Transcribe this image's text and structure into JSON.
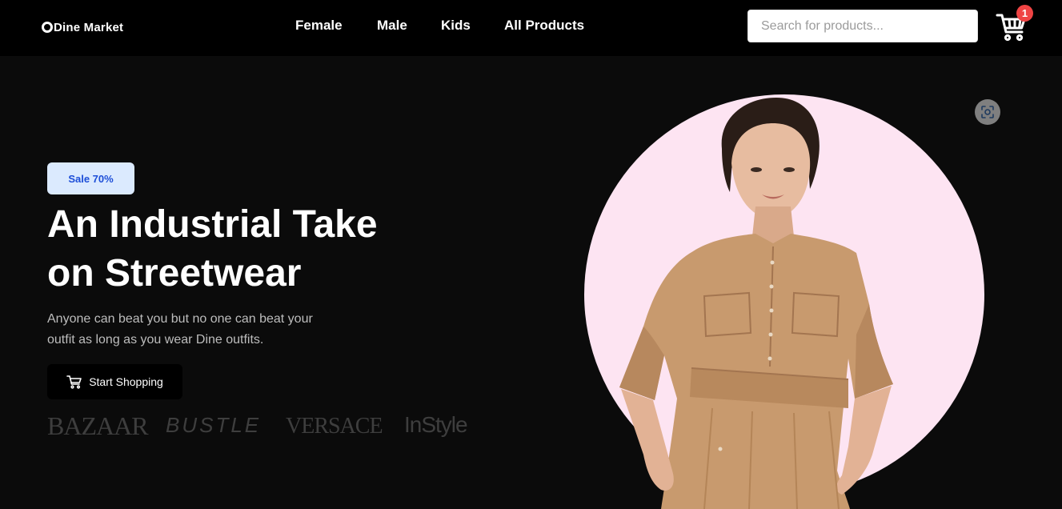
{
  "brand": {
    "name": "Dine Market"
  },
  "nav": {
    "items": [
      {
        "label": "Female"
      },
      {
        "label": "Male"
      },
      {
        "label": "Kids"
      },
      {
        "label": "All Products"
      }
    ]
  },
  "search": {
    "placeholder": "Search for products..."
  },
  "cart": {
    "count": "1",
    "icon": "shopping-cart-icon"
  },
  "hero": {
    "badge": "Sale 70%",
    "title_lines": [
      "An Industrial Take",
      "on Streetwear"
    ],
    "subtitle_lines": [
      "Anyone can beat you but no one can beat your",
      "outfit as long as you wear Dine outfits."
    ],
    "cta_label": "Start Shopping",
    "cta_icon": "shopping-cart-icon",
    "image_icon": "visual-search-icon"
  },
  "featured_brands": [
    "BAZAAR",
    "BUSTLE",
    "VERSACE",
    "InStyle"
  ],
  "colors": {
    "page_bg": "#0b0b0b",
    "header_bg": "#000000",
    "badge_bg": "#dbeafe",
    "badge_text": "#1d4ed8",
    "cart_badge": "#ef4444",
    "circle_bg": "#fde4f2",
    "brand_logo": "#3e3e3e"
  }
}
